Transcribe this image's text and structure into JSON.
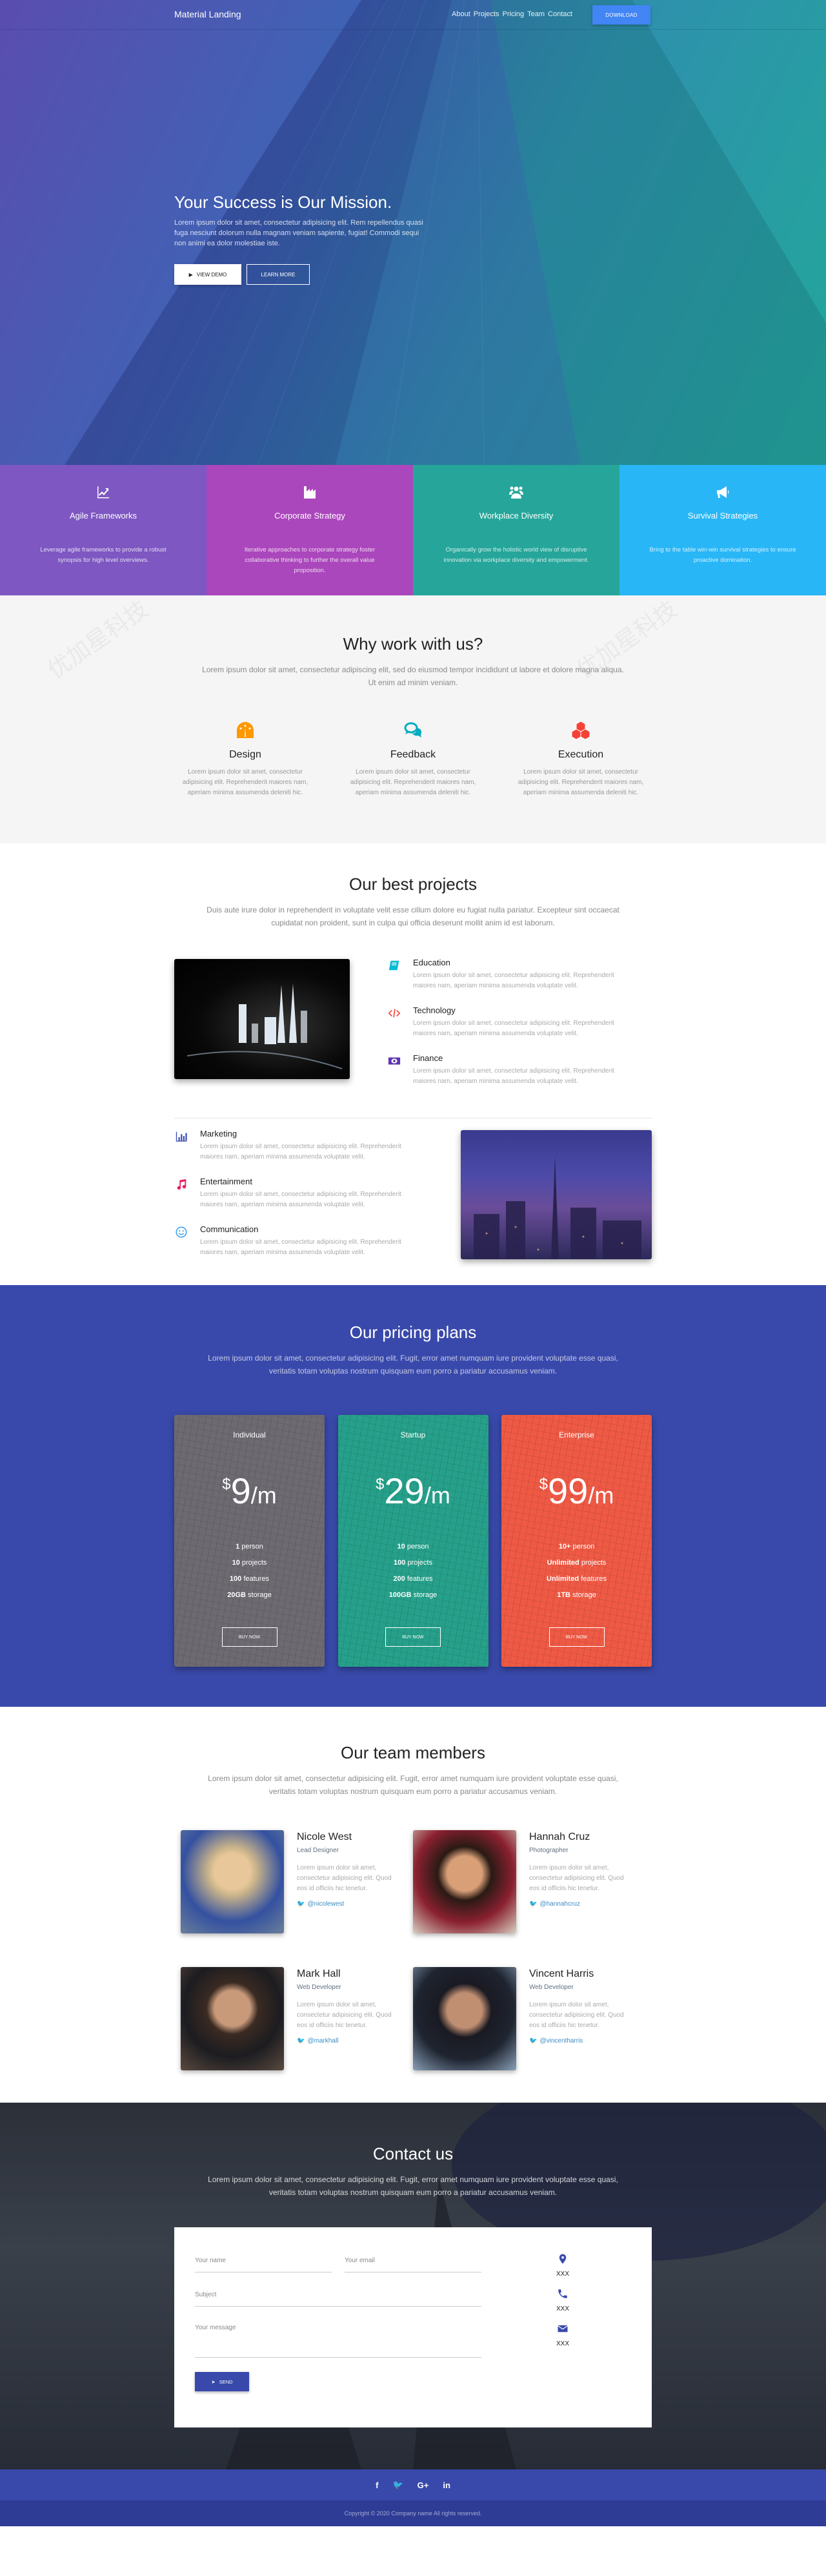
{
  "nav": {
    "brand": "Material Landing",
    "links": [
      "About",
      "Projects",
      "Pricing",
      "Team",
      "Contact"
    ],
    "download_label": "DOWNLOAD"
  },
  "hero": {
    "title": "Your Success is Our Mission.",
    "text": "Lorem ipsum dolor sit amet, consectetur adipisicing elit. Rem repellendus quasi fuga nesciunt dolorum nulla magnam veniam sapiente, fugiat! Commodi sequi non animi ea dolor molestiae iste.",
    "view_demo_label": "VIEW DEMO",
    "learn_more_label": "LEARN MORE"
  },
  "features": [
    {
      "icon": "trending-up-icon",
      "title": "Agile Frameworks",
      "text": "Leverage agile frameworks to provide a robust synopsis for high level overviews.",
      "color": "#7e57c2"
    },
    {
      "icon": "factory-icon",
      "title": "Corporate Strategy",
      "text": "Iterative approaches to corporate strategy foster collaborative thinking to further the overall value proposition.",
      "color": "#ab47bc"
    },
    {
      "icon": "group-icon",
      "title": "Workplace Diversity",
      "text": "Organically grow the holistic world view of disruptive innovation via workplace diversity and empowerment.",
      "color": "#26a69a"
    },
    {
      "icon": "megaphone-icon",
      "title": "Survival Strategies",
      "text": "Bring to the table win-win survival strategies to ensure proactive domination.",
      "color": "#29b6f6"
    }
  ],
  "why": {
    "title": "Why work with us?",
    "subtitle": "Lorem ipsum dolor sit amet, consectetur adipiscing elit, sed do eiusmod tempor incididunt ut labore et dolore magna aliqua. Ut enim ad minim veniam.",
    "items": [
      {
        "icon": "speedometer-icon",
        "title": "Design",
        "text": "Lorem ipsum dolor sit amet, consectetur adipisicing elit. Reprehenderit maiores nam, aperiam minima assumenda deleniti hic.",
        "color": "#ff9800"
      },
      {
        "icon": "chat-bubbles-icon",
        "title": "Feedback",
        "text": "Lorem ipsum dolor sit amet, consectetur adipisicing elit. Reprehenderit maiores nam, aperiam minima assumenda deleniti hic.",
        "color": "#00acc1"
      },
      {
        "icon": "cubes-icon",
        "title": "Execution",
        "text": "Lorem ipsum dolor sit amet, consectetur adipisicing elit. Reprehenderit maiores nam, aperiam minima assumenda deleniti hic.",
        "color": "#f44336"
      }
    ]
  },
  "projects": {
    "title": "Our best projects",
    "subtitle": "Duis aute irure dolor in reprehenderit in voluptate velit esse cillum dolore eu fugiat nulla pariatur. Excepteur sint occaecat cupidatat non proident, sunt in culpa qui officia deserunt mollit anim id est laborum.",
    "group1": [
      {
        "icon": "book-icon",
        "title": "Education",
        "text": "Lorem ipsum dolor sit amet, consectetur adipisicing elit. Reprehenderit maiores nam, aperiam minima assumenda voluptate velit.",
        "color": "#00bcd4"
      },
      {
        "icon": "code-icon",
        "title": "Technology",
        "text": "Lorem ipsum dolor sit amet, consectetur adipisicing elit. Reprehenderit maiores nam, aperiam minima assumenda voluptate velit.",
        "color": "#f44336"
      },
      {
        "icon": "money-icon",
        "title": "Finance",
        "text": "Lorem ipsum dolor sit amet, consectetur adipisicing elit. Reprehenderit maiores nam, aperiam minima assumenda voluptate velit.",
        "color": "#5e35b1"
      }
    ],
    "group2": [
      {
        "icon": "bar-chart-icon",
        "title": "Marketing",
        "text": "Lorem ipsum dolor sit amet, consectetur adipisicing elit. Reprehenderit maiores nam, aperiam minima assumenda voluptate velit.",
        "color": "#3f51b5"
      },
      {
        "icon": "music-icon",
        "title": "Entertainment",
        "text": "Lorem ipsum dolor sit amet, consectetur adipisicing elit. Reprehenderit maiores nam, aperiam minima assumenda voluptate velit.",
        "color": "#e91e63"
      },
      {
        "icon": "smile-icon",
        "title": "Communication",
        "text": "Lorem ipsum dolor sit amet, consectetur adipisicing elit. Reprehenderit maiores nam, aperiam minima assumenda voluptate velit.",
        "color": "#42a5f5"
      }
    ]
  },
  "pricing": {
    "title": "Our pricing plans",
    "subtitle": "Lorem ipsum dolor sit amet, consectetur adipisicing elit. Fugit, error amet numquam iure provident voluptate esse quasi, veritatis totam voluptas nostrum quisquam eum porro a pariatur accusamus veniam.",
    "plans": [
      {
        "name": "Individual",
        "currency": "$",
        "amount": "9",
        "period": "/m",
        "color": "#6d6a72",
        "features": [
          [
            "1",
            "person"
          ],
          [
            "10",
            "projects"
          ],
          [
            "100",
            "features"
          ],
          [
            "20GB",
            "storage"
          ]
        ],
        "buy_label": "BUY NOW"
      },
      {
        "name": "Startup",
        "currency": "$",
        "amount": "29",
        "period": "/m",
        "color": "#26a08a",
        "features": [
          [
            "10",
            "person"
          ],
          [
            "100",
            "projects"
          ],
          [
            "200",
            "features"
          ],
          [
            "100GB",
            "storage"
          ]
        ],
        "buy_label": "BUY NOW"
      },
      {
        "name": "Enterprise",
        "currency": "$",
        "amount": "99",
        "period": "/m",
        "color": "#ef5a45",
        "features": [
          [
            "10+",
            "person"
          ],
          [
            "Unlimited",
            "projects"
          ],
          [
            "Unlimited",
            "features"
          ],
          [
            "1TB",
            "storage"
          ]
        ],
        "buy_label": "BUY NOW"
      }
    ]
  },
  "team": {
    "title": "Our team members",
    "subtitle": "Lorem ipsum dolor sit amet, consectetur adipisicing elit. Fugit, error amet numquam iure provident voluptate esse quasi, veritatis totam voluptas nostrum quisquam eum porro a pariatur accusamus veniam.",
    "members": [
      {
        "name": "Nicole West",
        "role": "Lead Designer",
        "text": "Lorem ipsum dolor sit amet, consectetur adipisicing elit. Quod eos id officiis hic tenetur.",
        "twitter": "@nicolewest"
      },
      {
        "name": "Hannah Cruz",
        "role": "Photographer",
        "text": "Lorem ipsum dolor sit amet, consectetur adipisicing elit. Quod eos id officiis hic tenetur.",
        "twitter": "@hannahcruz"
      },
      {
        "name": "Mark Hall",
        "role": "Web Developer",
        "text": "Lorem ipsum dolor sit amet, consectetur adipisicing elit. Quod eos id officiis hic tenetur.",
        "twitter": "@markhall"
      },
      {
        "name": "Vincent Harris",
        "role": "Web Developer",
        "text": "Lorem ipsum dolor sit amet, consectetur adipisicing elit. Quod eos id officiis hic tenetur.",
        "twitter": "@vincentharris"
      }
    ]
  },
  "contact": {
    "title": "Contact us",
    "subtitle": "Lorem ipsum dolor sit amet, consectetur adipisicing elit. Fugit, error amet numquam iure provident voluptate esse quasi, veritatis totam voluptas nostrum quisquam eum porro a pariatur accusamus veniam.",
    "name_placeholder": "Your name",
    "email_placeholder": "Your email",
    "subject_placeholder": "Subject",
    "message_placeholder": "Your message",
    "send_label": "SEND",
    "address": "XXX",
    "phone": "XXX",
    "email": "XXX"
  },
  "footer": {
    "social": [
      "facebook",
      "twitter",
      "google-plus",
      "linkedin"
    ],
    "copyright": "Copyright © 2020 Company name All rights reserved."
  },
  "colors": {
    "primary": "#3949ab",
    "download_button": "#4285f4"
  }
}
